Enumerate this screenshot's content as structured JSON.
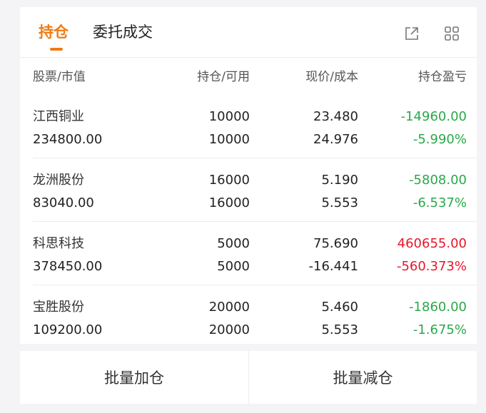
{
  "tabs": [
    {
      "label": "持仓"
    },
    {
      "label": "委托成交"
    }
  ],
  "header": {
    "col1": "股票/市值",
    "col2": "持仓/可用",
    "col3": "现价/成本",
    "col4": "持仓盈亏"
  },
  "rows": [
    {
      "name": "江西铜业",
      "market_value": "234800.00",
      "holding": "10000",
      "available": "10000",
      "price": "23.480",
      "cost": "24.976",
      "pl": "-14960.00",
      "pl_pct": "-5.990%",
      "status": "loss"
    },
    {
      "name": "龙洲股份",
      "market_value": "83040.00",
      "holding": "16000",
      "available": "16000",
      "price": "5.190",
      "cost": "5.553",
      "pl": "-5808.00",
      "pl_pct": "-6.537%",
      "status": "loss"
    },
    {
      "name": "科思科技",
      "market_value": "378450.00",
      "holding": "5000",
      "available": "5000",
      "price": "75.690",
      "cost": "-16.441",
      "pl": "460655.00",
      "pl_pct": "-560.373%",
      "status": "gain"
    },
    {
      "name": "宝胜股份",
      "market_value": "109200.00",
      "holding": "20000",
      "available": "20000",
      "price": "5.460",
      "cost": "5.553",
      "pl": "-1860.00",
      "pl_pct": "-1.675%",
      "status": "loss"
    }
  ],
  "actions": {
    "batch_add": "批量加仓",
    "batch_reduce": "批量减仓"
  },
  "icons": {
    "external": "external-link-icon",
    "grid": "grid-icon"
  },
  "colors": {
    "accent": "#f07b12",
    "gain": "#e8172a",
    "loss": "#2aa84a"
  }
}
